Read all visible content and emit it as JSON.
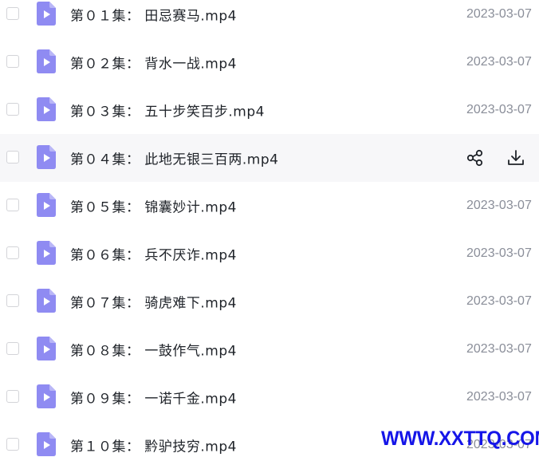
{
  "colors": {
    "file_icon": "#8f8bf2",
    "file_icon_fold": "#b9b6f7",
    "name_text": "#1f2329",
    "date_text": "#8a8e99",
    "hover_bg": "#f7f7f9",
    "action_icon": "#1f2329",
    "watermark": "#1515e8"
  },
  "icons": {
    "file": "video-file-icon",
    "share": "share-icon",
    "download": "download-icon"
  },
  "files": [
    {
      "name": "第０１集： 田忌赛马.mp4",
      "date": "2023-03-07"
    },
    {
      "name": "第０２集： 背水一战.mp4",
      "date": "2023-03-07"
    },
    {
      "name": "第０３集： 五十步笑百步.mp4",
      "date": "2023-03-07"
    },
    {
      "name": "第０４集： 此地无银三百两.mp4",
      "date": "",
      "hovered": true
    },
    {
      "name": "第０５集： 锦囊妙计.mp4",
      "date": "2023-03-07"
    },
    {
      "name": "第０６集： 兵不厌诈.mp4",
      "date": "2023-03-07"
    },
    {
      "name": "第０７集： 骑虎难下.mp4",
      "date": "2023-03-07"
    },
    {
      "name": "第０８集： 一鼓作气.mp4",
      "date": "2023-03-07"
    },
    {
      "name": "第０９集： 一诺千金.mp4",
      "date": "2023-03-07"
    },
    {
      "name": "第１０集： 黔驴技穷.mp4",
      "date": "2023-03-07"
    }
  ],
  "watermark": "WWW.XXTTQ.COM"
}
